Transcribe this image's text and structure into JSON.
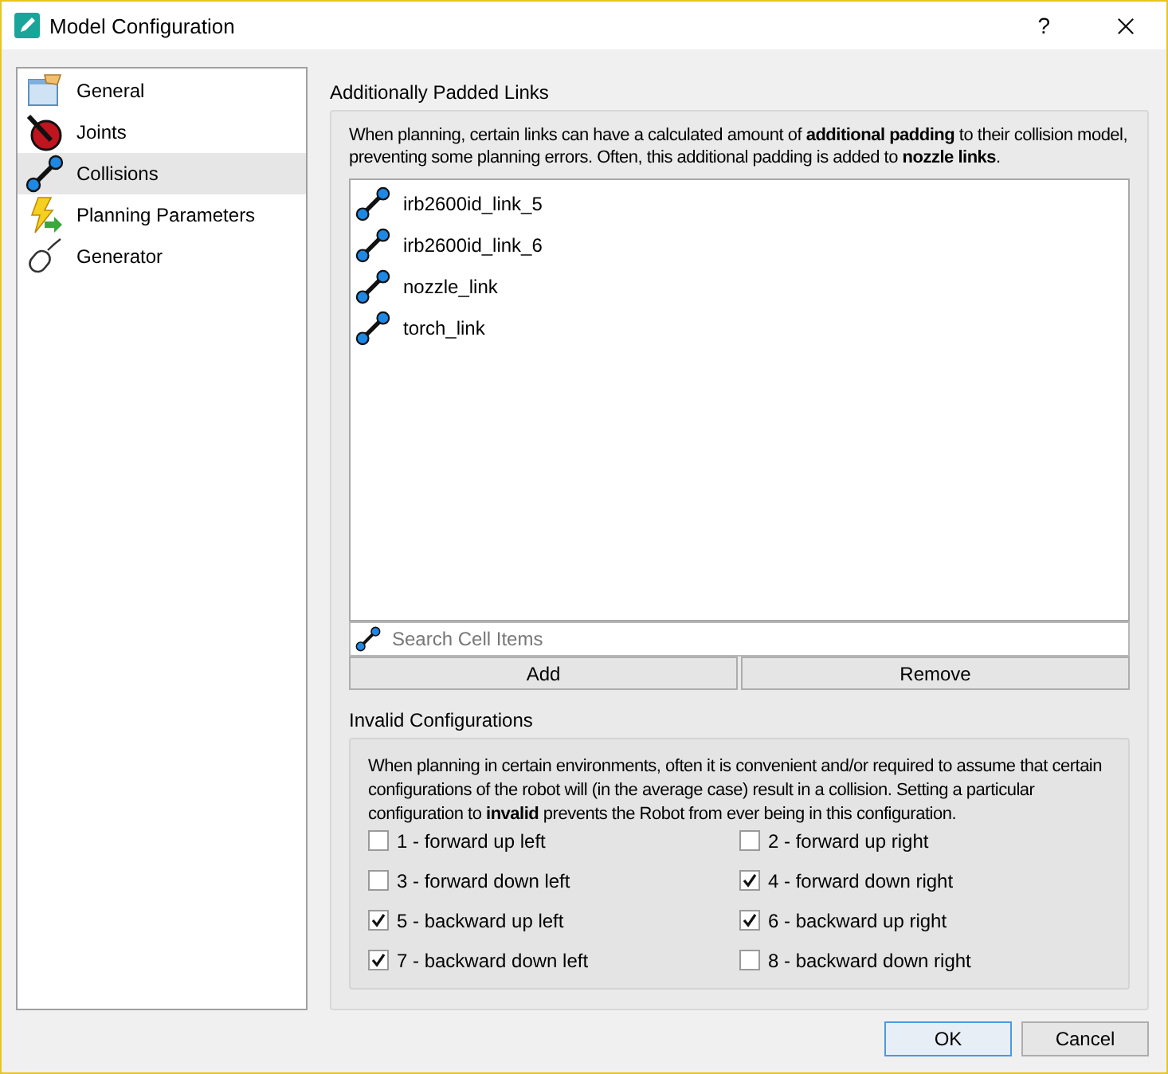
{
  "window": {
    "title": "Model Configuration",
    "help": "?"
  },
  "sidebar": {
    "items": [
      {
        "label": "General",
        "kind": "general",
        "selected": false
      },
      {
        "label": "Joints",
        "kind": "joints",
        "selected": false
      },
      {
        "label": "Collisions",
        "kind": "collisions",
        "selected": true
      },
      {
        "label": "Planning Parameters",
        "kind": "planning",
        "selected": false
      },
      {
        "label": "Generator",
        "kind": "generator",
        "selected": false
      }
    ]
  },
  "padded_links": {
    "title": "Additionally Padded Links",
    "description": "When planning, certain links can have a calculated amount of **additional padding** to their collision model, preventing some planning errors. Often, this additional padding is added to **nozzle links**.",
    "links": [
      "irb2600id_link_5",
      "irb2600id_link_6",
      "nozzle_link",
      "torch_link"
    ],
    "search": {
      "placeholder": "Search Cell Items"
    },
    "buttons": [
      "Add",
      "Remove"
    ]
  },
  "invalid_configurations": {
    "title": "Invalid Configurations",
    "description": "When planning in certain environments, often it is convenient and/or required to assume that certain configurations of the robot will (in the average case) result in a collision. Setting a particular configuration to **invalid** prevents the Robot from ever being in this configuration.",
    "options": [
      {
        "label": "1 - forward up left",
        "checked": false
      },
      {
        "label": "2 - forward up right",
        "checked": false
      },
      {
        "label": "3 - forward down left",
        "checked": false
      },
      {
        "label": "4 - forward down right",
        "checked": true
      },
      {
        "label": "5 - backward up left",
        "checked": true
      },
      {
        "label": "6 - backward up right",
        "checked": true
      },
      {
        "label": "7 - backward down left",
        "checked": true
      },
      {
        "label": "8 - backward down right",
        "checked": false
      }
    ]
  },
  "buttons": [
    "OK",
    "Cancel"
  ]
}
